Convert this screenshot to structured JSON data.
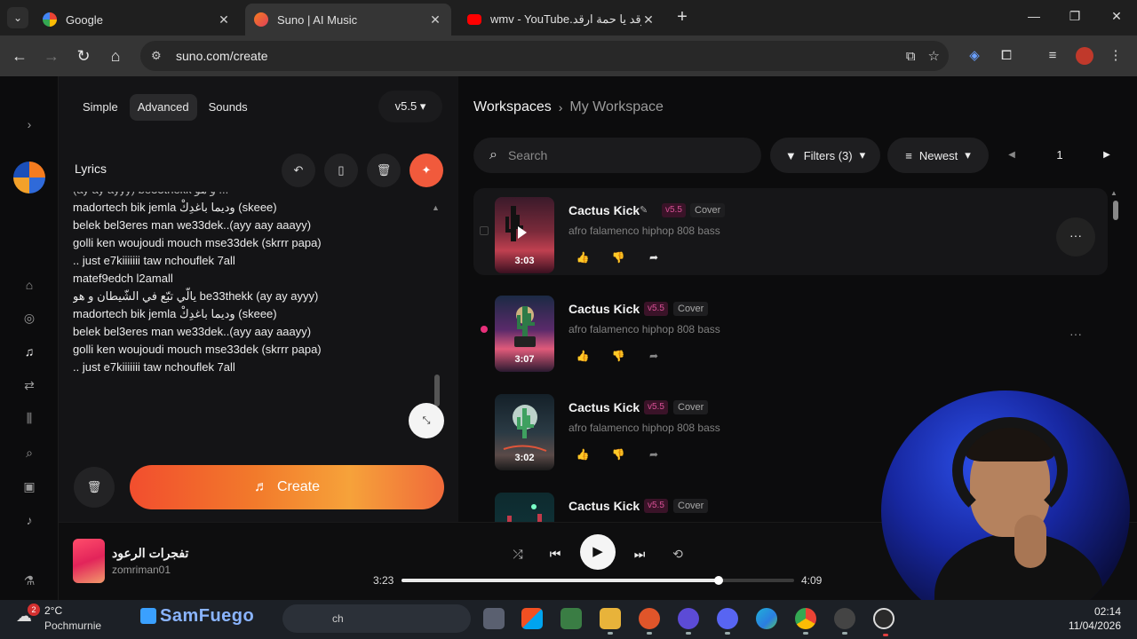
{
  "browser": {
    "tabs": [
      {
        "title": "Google",
        "close": "✕"
      },
      {
        "title": "Suno | AI Music",
        "close": "✕"
      },
      {
        "title": "wmv - YouTube.ارقد يا حمة ارقد",
        "close": "✕"
      }
    ],
    "new_tab": "+",
    "url": "suno.com/create",
    "icons": {
      "back": "←",
      "forward": "→",
      "reload": "↻",
      "home": "⌂",
      "tab_list": "⌄",
      "minimize": "—",
      "restore": "❐",
      "close": "✕",
      "menu": "⋮"
    }
  },
  "rail": {
    "icons": [
      "chevron-right-icon",
      "home-icon",
      "explore-icon",
      "create-icon",
      "remix-icon",
      "library-icon",
      "search-icon",
      "hooks-icon",
      "notifications-icon",
      "labs-icon"
    ]
  },
  "create": {
    "modes": [
      "Simple",
      "Advanced",
      "Sounds"
    ],
    "version": "v5.5",
    "lyrics_label": "Lyrics",
    "lyrics_lines": [
      "madortech bik jemla ودیما باغدِكْ (skeee)",
      "belek bel3eres man we33dek..(ayy aay aaayy)",
      "golli ken woujoudi mouch mse33dek (skrrr papa)",
      ".. just e7kiiiiiii  taw nchouflek 7all",
      "matef9edch l2amall",
      "يالّي تبّع في الشّيطان و هو be33thekk (ay ay ayyy)",
      "madortech bik jemla ودیما باغدِكْ (skeee)",
      "belek bel3eres man we33dek..(ayy aay aaayy)",
      "golli ken woujoudi mouch mse33dek (skrrr papa)",
      ".. just e7kiiiiiii  taw nchouflek 7all"
    ],
    "create_label": "Create"
  },
  "workspace": {
    "breadcrumb_root": "Workspaces",
    "breadcrumb_current": "My Workspace",
    "search_placeholder": "Search",
    "filters_label": "Filters (3)",
    "sort_label": "Newest",
    "page": "1",
    "songs": [
      {
        "title": "Cactus Kick",
        "version": "v5.5",
        "type": "Cover",
        "tags": "afro falamenco hiphop 808 bass",
        "duration": "3:03"
      },
      {
        "title": "Cactus Kick",
        "version": "v5.5",
        "type": "Cover",
        "tags": "afro falamenco hiphop 808 bass",
        "duration": "3:07"
      },
      {
        "title": "Cactus Kick",
        "version": "v5.5",
        "type": "Cover",
        "tags": "afro falamenco hiphop 808 bass",
        "duration": "3:02"
      },
      {
        "title": "Cactus Kick",
        "version": "v5.5",
        "type": "Cover",
        "tags": "",
        "duration": ""
      }
    ]
  },
  "player": {
    "title": "تفجرات الرعود",
    "artist": "zomriman01",
    "current_time": "3:23",
    "total_time": "4:09",
    "progress": 0.808
  },
  "taskbar": {
    "weather_badge": "2",
    "temperature": "2°C",
    "location": "Pochmurnie",
    "brand": "SamFuego",
    "search_text": "ch",
    "time": "02:14",
    "date": "11/04/2026"
  },
  "colors": {
    "accent_orange": "#f15a3c",
    "version_pink": "#d85196",
    "live_dot": "#e8307a"
  }
}
